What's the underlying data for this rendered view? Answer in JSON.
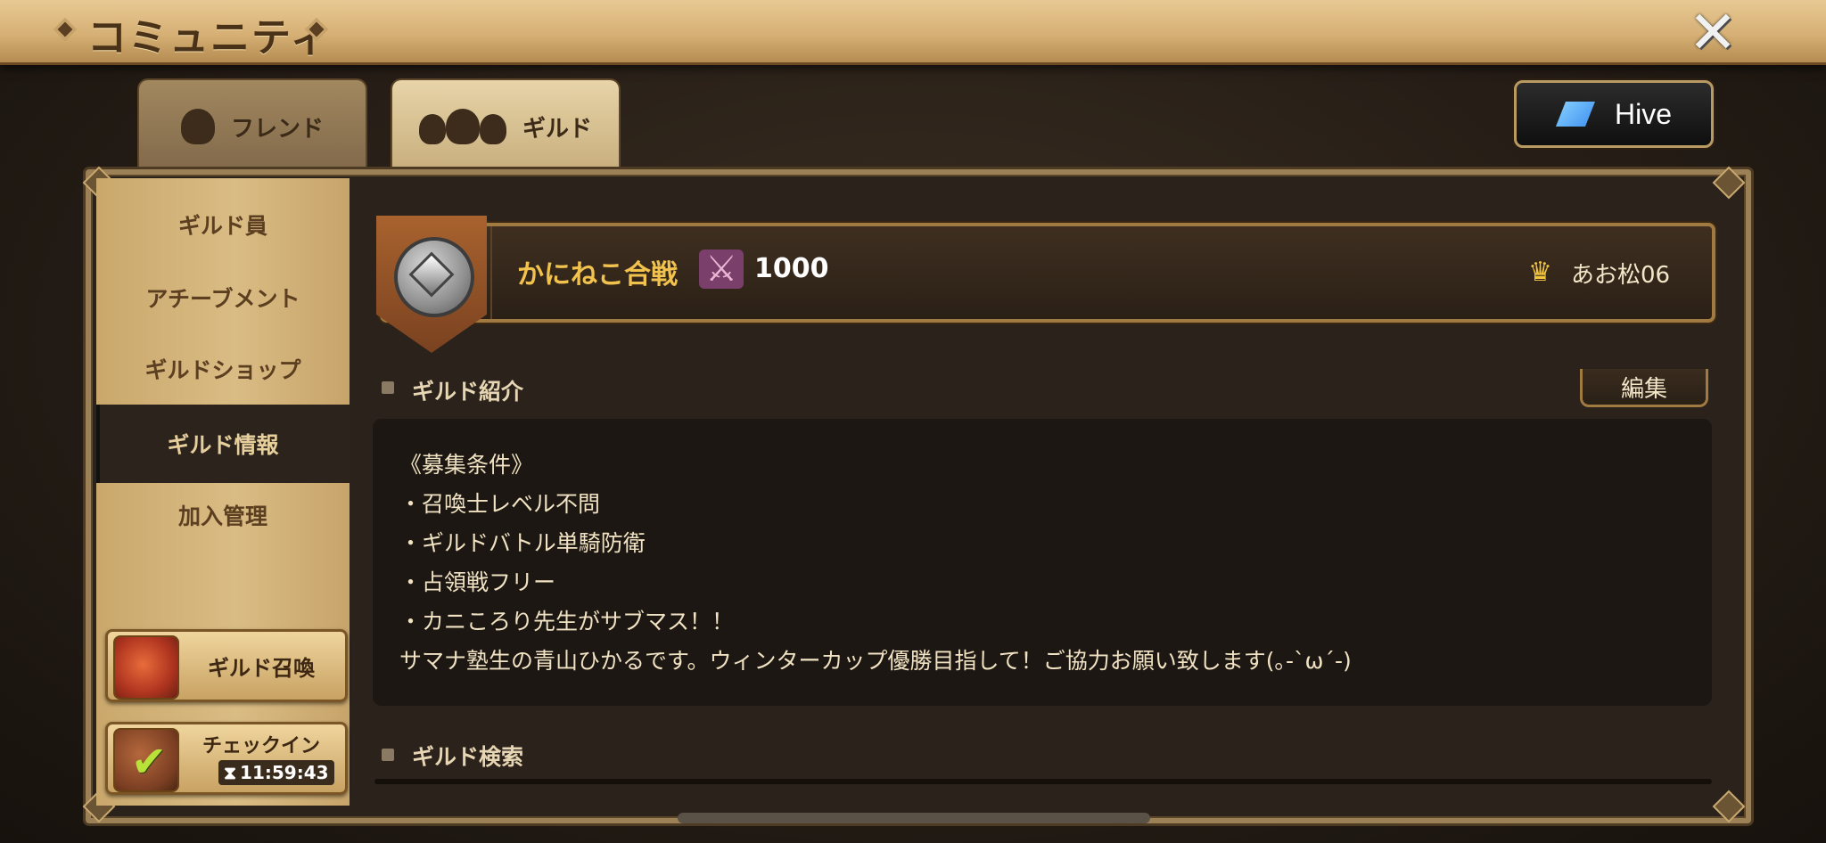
{
  "window": {
    "title": "コミュニティ"
  },
  "tabs": [
    {
      "label": "フレンド",
      "icon": "friend-icon"
    },
    {
      "label": "ギルド",
      "icon": "guild-members-icon"
    }
  ],
  "hive": {
    "label": "Hive",
    "icon": "hive-logo-icon"
  },
  "sidebar": {
    "items": [
      {
        "label": "ギルド員"
      },
      {
        "label": "アチーブメント"
      },
      {
        "label": "ギルドショップ"
      },
      {
        "label": "ギルド情報",
        "active": true
      },
      {
        "label": "加入管理"
      }
    ],
    "summon_button": {
      "label": "ギルド召喚"
    },
    "checkin_button": {
      "label": "チェックイン",
      "timer": "11:59:43"
    }
  },
  "guild": {
    "name": "かにねこ合戦",
    "score": "1000",
    "master": "あお松06"
  },
  "sections": {
    "intro_title": "ギルド紹介",
    "edit_label": "編集",
    "search_title": "ギルド検索"
  },
  "intro_lines": [
    "《募集条件》",
    "・召喚士レベル不問",
    "・ギルドバトル単騎防衛",
    "・占領戦フリー",
    "・カニころり先生がサブマス！！",
    "サマナ塾生の青山ひかるです。ウィンターカップ優勝目指して！ご協力お願い致します(｡-`ω´-)"
  ],
  "colors": {
    "accent_gold": "#f1c24d",
    "panel_bg": "#2a221b",
    "title_bar": "#d6b075"
  }
}
